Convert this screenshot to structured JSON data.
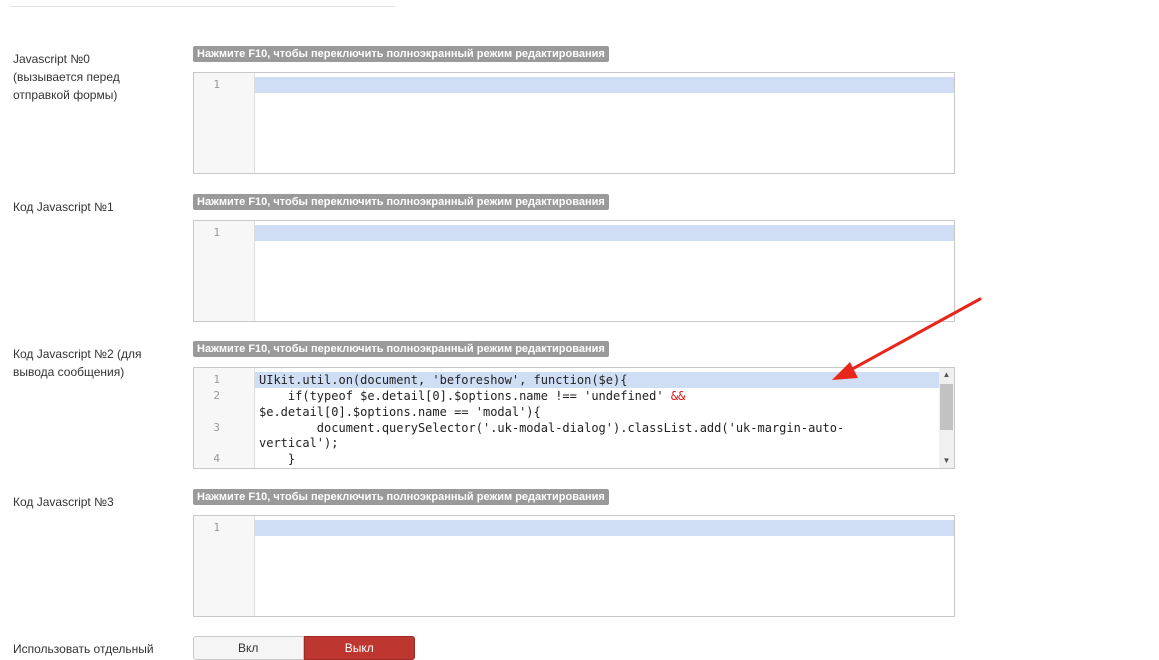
{
  "hint_text": "Нажмите F10, чтобы переключить полноэкранный режим редактирования",
  "fields": [
    {
      "label_lines": [
        "Javascript №0",
        "(вызывается перед",
        "отправкой формы)"
      ]
    },
    {
      "label_lines": [
        "Код Javascript №1"
      ]
    },
    {
      "label_lines": [
        "Код Javascript №2 (для",
        "вывода сообщения)"
      ]
    },
    {
      "label_lines": [
        "Код Javascript №3"
      ]
    }
  ],
  "editors": [
    {
      "line_numbers": [
        "1"
      ]
    },
    {
      "line_numbers": [
        "1"
      ]
    },
    {
      "line_numbers": [
        "1",
        "2",
        "3",
        "4"
      ],
      "code_lines": [
        "UIkit.util.on(document, 'beforeshow', function($e){",
        "    if(typeof $e.detail[0].$options.name !== 'undefined' ",
        "&&",
        "$e.detail[0].$options.name == 'modal'){",
        "        document.querySelector('.uk-modal-dialog').classList.add('uk-margin-auto-",
        "vertical');",
        "    }"
      ]
    },
    {
      "line_numbers": [
        "1"
      ]
    }
  ],
  "separate_field": {
    "label": "Использовать отдельный",
    "on_label": "Вкл",
    "off_label": "Выкл",
    "selected": "Выкл"
  },
  "colors": {
    "active_line": "#cfdef5",
    "hint_bg": "#9a9a9a",
    "toggle_off_bg": "#bd362f",
    "arrow": "#e8261c"
  },
  "icons": {
    "scroll_up": "chevron-up-icon",
    "scroll_down": "chevron-down-icon",
    "annotation": "red-arrow-icon"
  }
}
